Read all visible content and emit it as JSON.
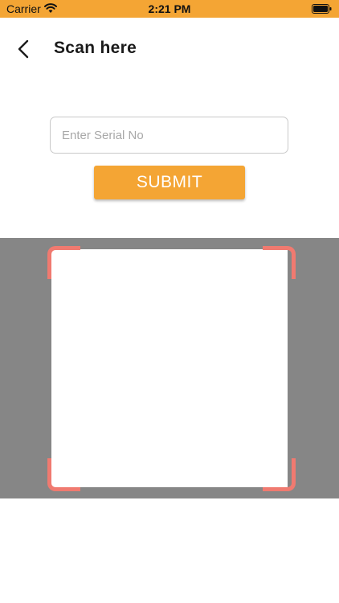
{
  "status_bar": {
    "carrier": "Carrier",
    "time": "2:21 PM",
    "wifi_icon": "wifi-icon",
    "battery_icon": "battery-icon",
    "background_color": "#f4a534"
  },
  "header": {
    "back_icon": "chevron-left-icon",
    "title": "Scan here"
  },
  "form": {
    "serial_placeholder": "Enter Serial No",
    "serial_value": "",
    "submit_label": "SUBMIT",
    "accent_color": "#f4a534"
  },
  "scanner": {
    "overlay_color": "#868686",
    "corner_color": "#f07a70"
  }
}
